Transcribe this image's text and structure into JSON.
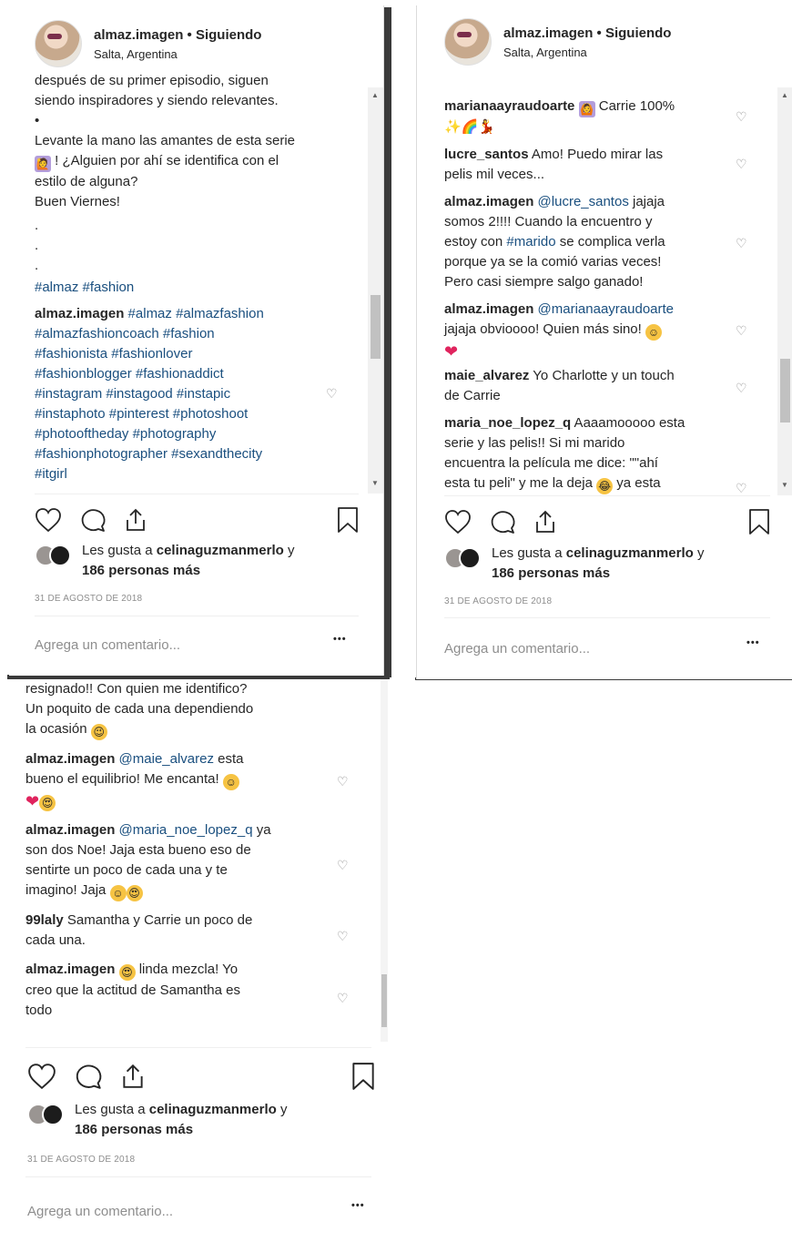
{
  "header": {
    "username": "almaz.imagen",
    "separator": " • ",
    "following": "Siguiendo",
    "location": "Salta, Argentina"
  },
  "panel1": {
    "caption_lines": [
      "después de su primer episodio, siguen",
      "siendo inspiradores y siendo relevantes.",
      "•",
      "Levante la mano las amantes de esta serie",
      " ! ¿Alguien por ahí se identifica con el",
      "estilo de alguna?",
      "Buen Viernes!",
      ".",
      ".",
      "."
    ],
    "caption_tags": "#almaz #fashion",
    "comment_user": "almaz.imagen",
    "comment_lines": [
      "#almaz #almazfashion",
      "#almazfashioncoach #fashion",
      "#fashionista #fashionlover",
      "#fashionblogger #fashionaddict",
      "#instagram #instagood #instapic",
      "#instaphoto #pinterest #photoshoot",
      "#photooftheday #photography",
      "#fashionphotographer #sexandthecity",
      "#itgirl"
    ]
  },
  "panel2": {
    "comments": [
      {
        "user": "marianaayraudoarte",
        "text1": " Carrie 100%",
        "rest": []
      },
      {
        "user": "lucre_santos",
        "text1": " Amo! Puedo mirar las",
        "rest": [
          "pelis mil veces..."
        ]
      },
      {
        "user": "almaz.imagen",
        "mention": " @lucre_santos",
        "text1": " jajaja",
        "rest": [
          "somos 2!!!! Cuando la encuentro y",
          "estoy con ",
          "porque ya se la comió varias veces!",
          "Pero casi siempre salgo ganado!"
        ],
        "hashtag": "#marido",
        "after_hashtag": " se complica verla"
      },
      {
        "user": "almaz.imagen",
        "mention": " @marianaayraudoarte",
        "rest": [
          "jajaja obvioooo! Quien más sino! "
        ]
      },
      {
        "user": "maie_alvarez",
        "text1": " Yo Charlotte y un touch",
        "rest": [
          "de Carrie"
        ]
      },
      {
        "user": "maria_noe_lopez_q",
        "text1": " Aaaamooooo esta",
        "rest": [
          "serie y las pelis!! Si mi marido",
          "encuentra la película me dice: \"\"ahí",
          "esta tu peli\" y me la deja ",
          "ya esta"
        ]
      }
    ]
  },
  "panel3": {
    "top_lines": [
      "resignado!! Con quien me identifico?",
      "Un poquito de cada una dependiendo",
      "la ocasión "
    ],
    "comments": [
      {
        "user": "almaz.imagen",
        "mention": " @maie_alvarez",
        "text1": " esta",
        "rest": [
          "bueno el equilibrio! Me encanta! "
        ]
      },
      {
        "user": "almaz.imagen",
        "mention": " @maria_noe_lopez_q",
        "text1": " ya",
        "rest": [
          "son dos Noe! Jaja esta bueno eso de",
          "sentirte un poco de cada una y te",
          "imagino! Jaja "
        ]
      },
      {
        "user": "99laly",
        "text1": " Samantha y Carrie un poco de",
        "rest": [
          "cada una."
        ]
      },
      {
        "user": "almaz.imagen",
        "text1": " linda mezcla! Yo",
        "rest": [
          "creo que la actitud de Samantha es",
          "todo"
        ]
      }
    ]
  },
  "likes": {
    "prefix": "Les gusta a ",
    "user": "celinaguzmanmerlo",
    "suffix": " y",
    "others": "186 personas más"
  },
  "date": "31 DE AGOSTO DE 2018",
  "add_comment_placeholder": "Agrega un comentario...",
  "more_label": "•••",
  "heart_glyph": "♡",
  "colors": {
    "link": "#1a4f7f",
    "text": "#262626",
    "muted": "#8e8e8e"
  }
}
